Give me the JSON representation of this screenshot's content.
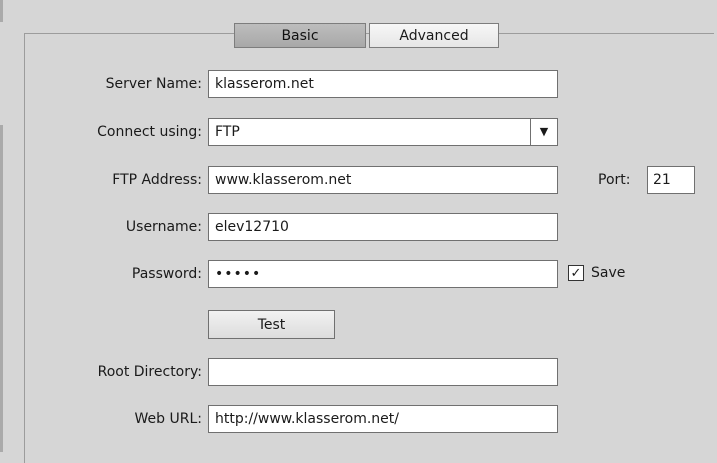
{
  "tabs": {
    "basic": "Basic",
    "advanced": "Advanced"
  },
  "form": {
    "server_name": {
      "label": "Server Name:",
      "value": "klasserom.net"
    },
    "connect_using": {
      "label": "Connect using:",
      "value": "FTP"
    },
    "ftp_address": {
      "label": "FTP Address:",
      "value": "www.klasserom.net"
    },
    "port": {
      "label": "Port:",
      "value": "21"
    },
    "username": {
      "label": "Username:",
      "value": "elev12710"
    },
    "password": {
      "label": "Password:",
      "value": "•••••"
    },
    "save": {
      "label": "Save",
      "checked": true
    },
    "test_button": "Test",
    "root_directory": {
      "label": "Root Directory:",
      "value": ""
    },
    "web_url": {
      "label": "Web URL:",
      "value": "http://www.klasserom.net/"
    }
  },
  "icons": {
    "dropdown": "chevron-down-icon",
    "check": "checkmark-icon"
  }
}
